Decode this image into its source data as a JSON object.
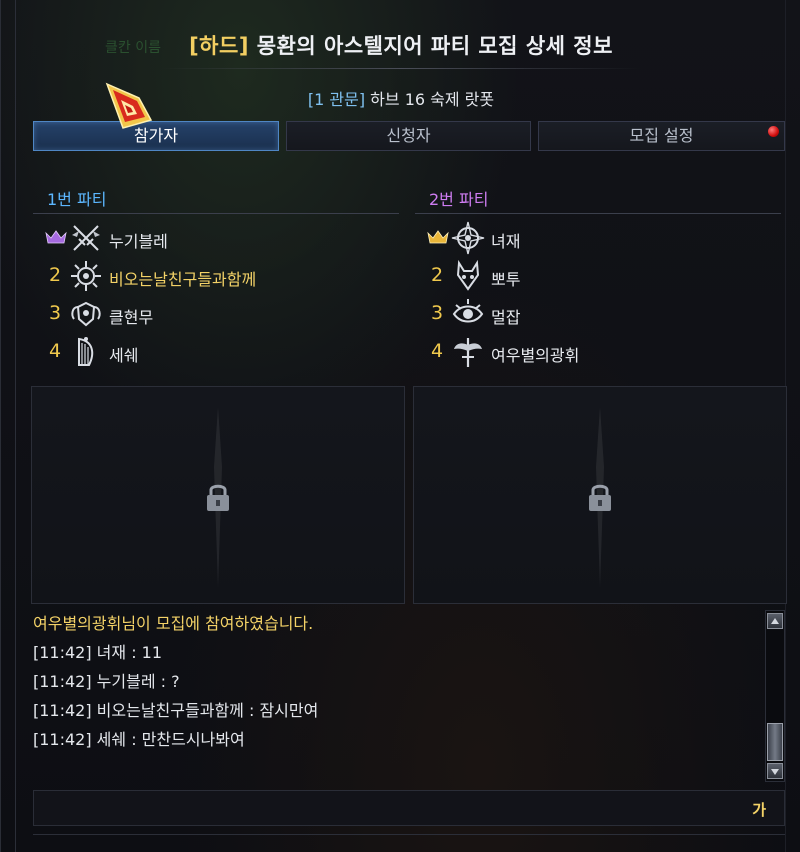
{
  "window": {
    "title_tag": "[하드]",
    "title_rest": "몽환의 아스텔지어 파티 모집 상세 정보",
    "subtitle_bracket": "[1 관문]",
    "subtitle_rest": "하브 16 숙제 랏폿",
    "ghost_text": "클칸 이름"
  },
  "tabs": [
    {
      "label": "참가자",
      "active": true
    },
    {
      "label": "신청자",
      "active": false
    },
    {
      "label": "모집 설정",
      "active": false,
      "notification": true
    }
  ],
  "parties": [
    {
      "title": "1번 파티",
      "color": "#5cb7ff",
      "members": [
        {
          "slot": "leader",
          "name": "누기블레",
          "class_icon": "swords-crossed-icon",
          "crown_color": "#a66ae0"
        },
        {
          "slot": "2",
          "name": "비오는날친구들과함께",
          "class_icon": "sun-wheel-icon",
          "highlight": true
        },
        {
          "slot": "3",
          "name": "클현무",
          "class_icon": "winged-shield-icon"
        },
        {
          "slot": "4",
          "name": "세쉐",
          "class_icon": "harp-icon"
        }
      ]
    },
    {
      "title": "2번 파티",
      "color": "#cf7df2",
      "members": [
        {
          "slot": "leader",
          "name": "녀재",
          "class_icon": "compass-star-icon",
          "crown_color": "#e9b63a"
        },
        {
          "slot": "2",
          "name": "뽀투",
          "class_icon": "horned-mask-icon"
        },
        {
          "slot": "3",
          "name": "멀잡",
          "class_icon": "eye-emblem-icon"
        },
        {
          "slot": "4",
          "name": "여우별의광휘",
          "class_icon": "winged-sword-icon"
        }
      ]
    }
  ],
  "locked_slots": [
    {
      "icon": "lock-icon"
    },
    {
      "icon": "lock-icon"
    }
  ],
  "chat": {
    "lines": [
      {
        "text": "여우별의광휘님이 모집에 참여하였습니다.",
        "type": "system"
      },
      {
        "text": "[11:42] 녀재 : 11",
        "type": "user"
      },
      {
        "text": "[11:42] 누기블레 : ?",
        "type": "user"
      },
      {
        "text": "[11:42] 비오는날친구들과함께 : 잠시만여",
        "type": "user"
      },
      {
        "text": "[11:42] 세쉐 : 만찬드시나봐여",
        "type": "user"
      }
    ],
    "input_value": "",
    "ime_indicator": "가"
  },
  "colors": {
    "accent_gold": "#f3cf62",
    "tab_active": "#4f86c4",
    "notification_red": "#d10d0d"
  }
}
